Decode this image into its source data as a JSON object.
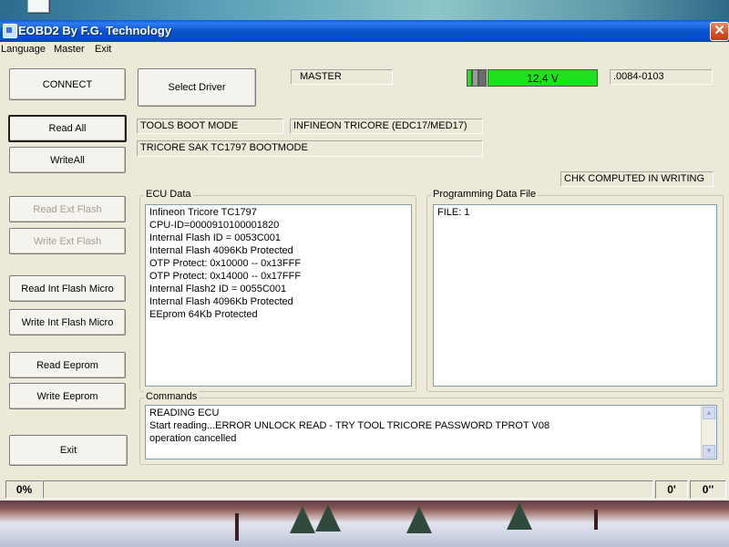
{
  "window": {
    "title": "EOBD2 By F.G. Technology",
    "close_glyph": "✕"
  },
  "menu": [
    "Language",
    "Master",
    "Exit"
  ],
  "buttons": {
    "connect": "CONNECT",
    "select_driver": "Select Driver",
    "read_all": "Read All",
    "write_all": "WriteAll",
    "read_ext_flash": "Read Ext Flash",
    "write_ext_flash": "Write Ext Flash",
    "read_int_flash": "Read Int Flash Micro",
    "write_int_flash": "Write Int Flash Micro",
    "read_eeprom": "Read Eeprom",
    "write_eeprom": "Write Eeprom",
    "exit": "Exit"
  },
  "fields": {
    "master": "MASTER",
    "voltage": "12,4 V",
    "version": ".0084-0103",
    "boot_mode": "TOOLS BOOT MODE",
    "ecu_type": "INFINEON TRICORE (EDC17/MED17)",
    "sak": "TRICORE SAK TC1797  BOOTMODE",
    "chk": "CHK COMPUTED IN WRITING"
  },
  "ecu_data": {
    "label": "ECU Data",
    "lines": [
      "Infineon Tricore TC1797",
      "CPU-ID=0000910100001820",
      "Internal Flash ID = 0053C001",
      "Internal Flash 4096Kb  Protected",
      "OTP Protect: 0x10000 -- 0x13FFF",
      "OTP Protect: 0x14000 -- 0x17FFF",
      "Internal Flash2 ID = 0055C001",
      "Internal Flash 4096Kb  Protected",
      "EEprom 64Kb  Protected"
    ]
  },
  "programming": {
    "label": "Programming Data File",
    "lines": [
      "FILE: 1"
    ]
  },
  "commands": {
    "label": "Commands",
    "lines": [
      "READING ECU",
      "Start reading...ERROR UNLOCK READ - TRY TOOL TRICORE PASSWORD TPROT V08",
      "operation cancelled"
    ]
  },
  "status": {
    "percent": "0%",
    "progress_fraction": 0,
    "minutes": "0'",
    "seconds": "0''"
  },
  "colors": {
    "voltage_ok": "#1fe01c",
    "title_bar": "#0a5bd8",
    "close": "#d24d22"
  }
}
